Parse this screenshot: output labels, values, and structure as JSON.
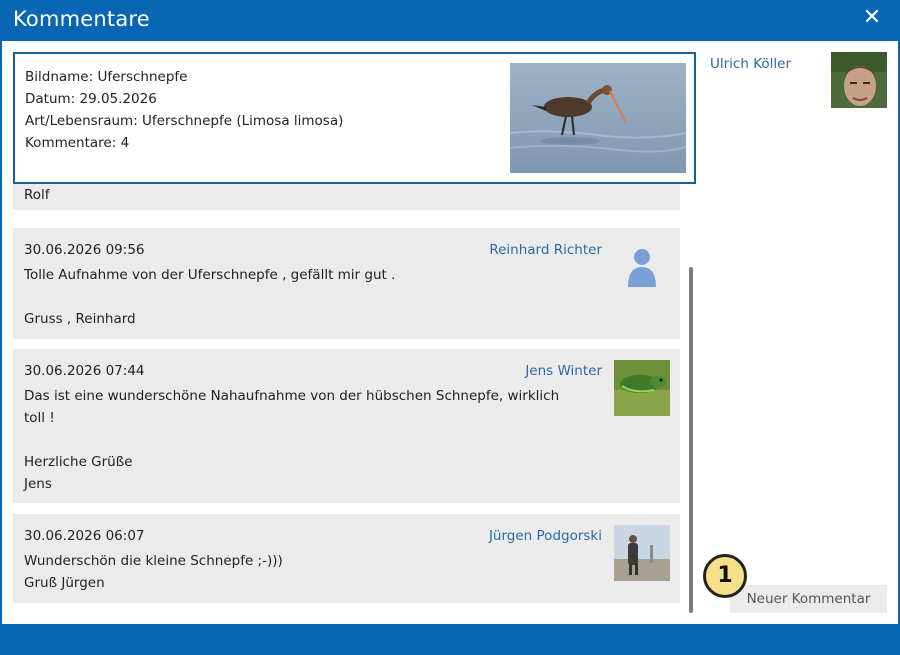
{
  "window": {
    "title": "Kommentare",
    "close_symbol": "✕"
  },
  "image_info": {
    "lines": [
      "Bildname: Uferschnepfe",
      "Datum: 29.05.2026",
      "Art/Lebensraum: Uferschnepfe (Limosa limosa)",
      "Kommentare: 4"
    ]
  },
  "comments": [
    {
      "partial_text": "Rolf"
    },
    {
      "date": "30.06.2026 09:56",
      "author": "Reinhard Richter",
      "lines": [
        "Tolle Aufnahme von der Uferschnepfe , gefällt mir gut .",
        "",
        "Gruss , Reinhard"
      ]
    },
    {
      "date": "30.06.2026 07:44",
      "author": "Jens Winter",
      "lines": [
        "Das ist eine wunderschöne Nahaufnahme von der hübschen Schnepfe, wirklich",
        "toll !",
        "",
        "Herzliche Grüße",
        "Jens"
      ]
    },
    {
      "date": "30.06.2026 06:07",
      "author": "Jürgen Podgorski",
      "lines": [
        "Wunderschön die kleine Schnepfe ;-)))",
        "Gruß Jürgen"
      ]
    }
  ],
  "current_user": {
    "name": "Ulrich Köller"
  },
  "actions": {
    "new_comment_label": "Neuer Kommentar"
  },
  "annotation": {
    "marker_number": "1"
  },
  "colors": {
    "brand_blue": "#0767b5",
    "link_blue": "#2a6aa7",
    "card_gray": "#ebebeb"
  }
}
